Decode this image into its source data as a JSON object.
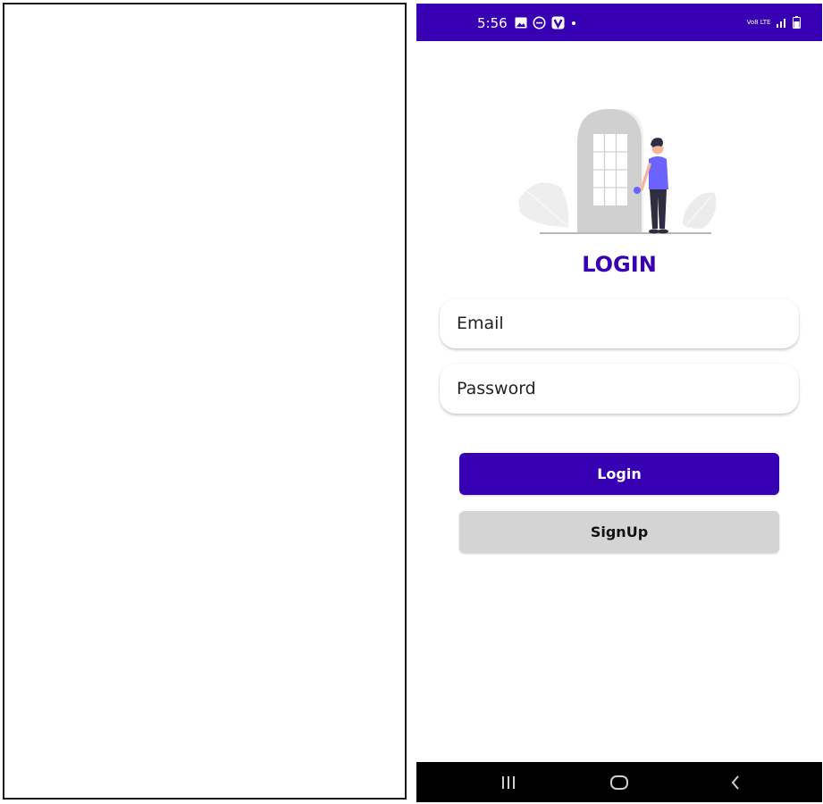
{
  "status_bar": {
    "time": "5:56",
    "left_icons": [
      "gallery-icon",
      "do-not-disturb-icon",
      "vpn-icon",
      "notification-dot-icon"
    ],
    "right_icons": [
      "volte-lte-icon",
      "signal-icon",
      "battery-icon"
    ],
    "volte_label": "Vo8 LTE",
    "background_color": "#3700b3"
  },
  "login_screen": {
    "title": "LOGIN",
    "email_placeholder": "Email",
    "password_placeholder": "Password",
    "login_button": "Login",
    "signup_button": "SignUp",
    "accent_color": "#3700b3",
    "secondary_button_color": "#d4d4d4"
  },
  "nav_bar": {
    "icons": [
      "recent-apps-icon",
      "home-icon",
      "back-icon"
    ]
  }
}
